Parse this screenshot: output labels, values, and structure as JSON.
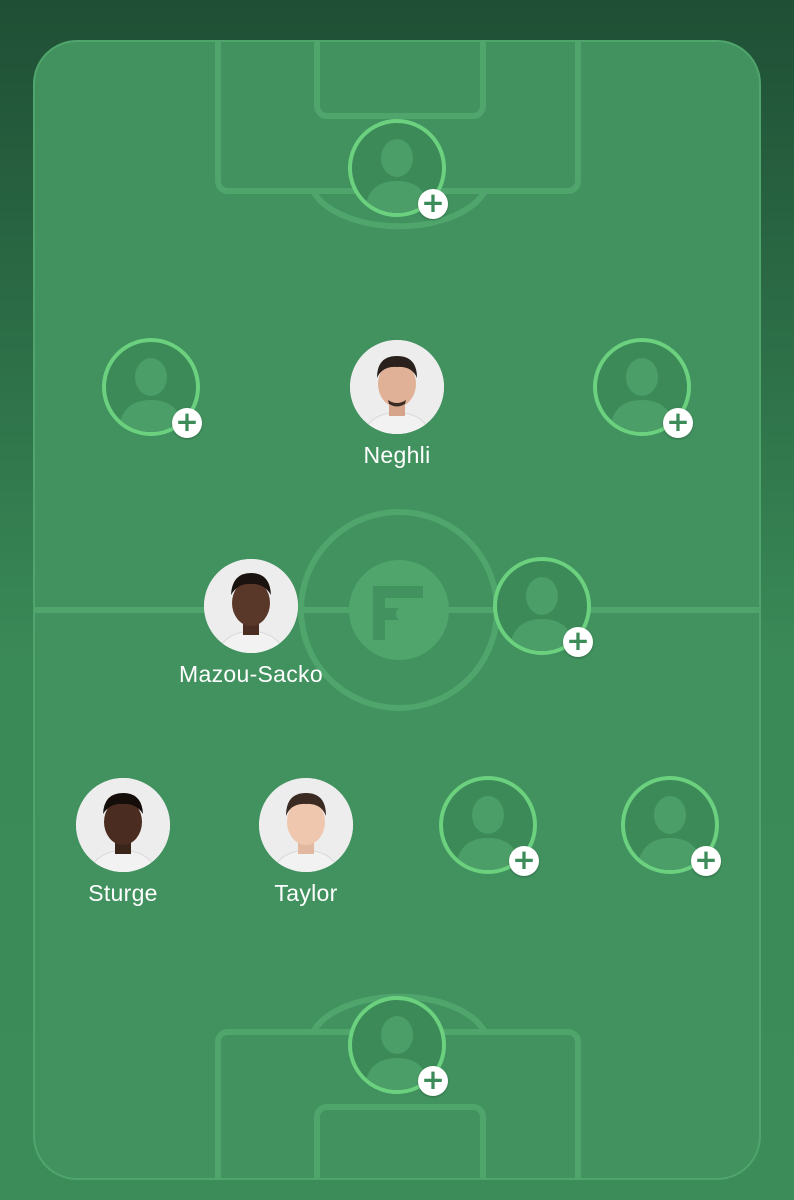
{
  "colors": {
    "pitch": "#41925f",
    "pitch_lines": "#4fa56c",
    "empty_ring": "#6bd17f",
    "plus_button_bg": "#ffffff",
    "plus_button_fg": "#3b8c58",
    "name_text": "#ffffff"
  },
  "icons": {
    "empty_slot": "person-silhouette-icon",
    "add": "plus-icon",
    "center_logo": "brand-logo-icon"
  },
  "lineup": {
    "slots": [
      {
        "id": "gk-top",
        "filled": false,
        "add_symbol": "+"
      },
      {
        "id": "row2-left",
        "filled": false,
        "add_symbol": "+"
      },
      {
        "id": "row2-center",
        "filled": true,
        "name": "Neghli"
      },
      {
        "id": "row2-right",
        "filled": false,
        "add_symbol": "+"
      },
      {
        "id": "row3-left",
        "filled": true,
        "name": "Mazou-Sacko"
      },
      {
        "id": "row3-right",
        "filled": false,
        "add_symbol": "+"
      },
      {
        "id": "row4-1",
        "filled": true,
        "name": "Sturge"
      },
      {
        "id": "row4-2",
        "filled": true,
        "name": "Taylor"
      },
      {
        "id": "row4-3",
        "filled": false,
        "add_symbol": "+"
      },
      {
        "id": "row4-4",
        "filled": false,
        "add_symbol": "+"
      },
      {
        "id": "gk-bottom",
        "filled": false,
        "add_symbol": "+"
      }
    ]
  }
}
